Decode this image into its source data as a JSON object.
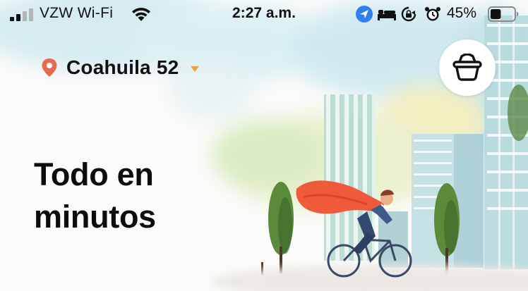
{
  "status_bar": {
    "carrier": "VZW Wi-Fi",
    "time": "2:27 a.m.",
    "battery_percent": "45%",
    "battery_level": 0.45,
    "signal_bars_active": 2,
    "icons": [
      "cellular-signal-icon",
      "wifi-icon",
      "location-arrow-icon",
      "bed-icon",
      "rotation-lock-icon",
      "alarm-clock-icon",
      "battery-icon"
    ]
  },
  "header": {
    "location_name": "Coahuila 52",
    "location_icon": "map-pin-icon",
    "dropdown_icon": "caret-down-icon",
    "cart_icon": "basket-icon"
  },
  "hero": {
    "headline_line1": "Todo en",
    "headline_line2": "minutos"
  },
  "colors": {
    "pin": "#e9694f",
    "caret": "#f0a13a",
    "location_arrow": "#2f80ed",
    "cape": "#ee5a3a",
    "headline": "#0d0d0d"
  }
}
